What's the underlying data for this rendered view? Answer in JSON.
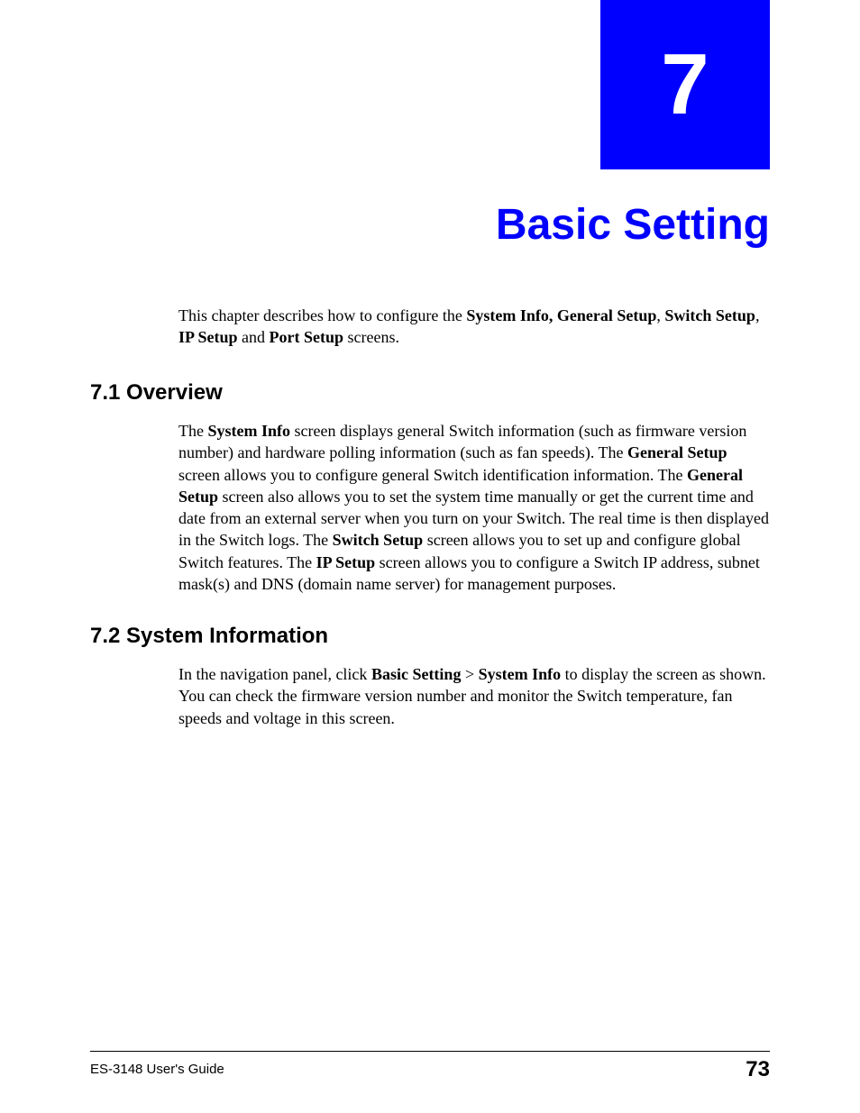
{
  "chapter": {
    "number": "7",
    "title": "Basic Setting"
  },
  "intro": {
    "prefix": "This chapter describes how to configure the ",
    "bold1": "System Info, General Setup",
    "mid1": ", ",
    "bold2": "Switch Setup",
    "mid2": ", ",
    "bold3": "IP Setup",
    "mid3": " and ",
    "bold4": "Port Setup",
    "suffix": " screens."
  },
  "section1": {
    "heading": "7.1  Overview",
    "p1_a": "The ",
    "p1_b": "System Info",
    "p1_c": " screen displays general Switch information (such as firmware version number) and hardware polling information (such as fan speeds). The ",
    "p1_d": "General Setup",
    "p1_e": " screen allows you to configure general Switch identification information. The ",
    "p1_f": "General Setup",
    "p1_g": " screen also allows you to set the system time manually or get the current time and date from an external server when you turn on your Switch. The real time is then displayed in the Switch logs. The ",
    "p1_h": "Switch Setup",
    "p1_i": " screen allows you to set up and configure global Switch features. The ",
    "p1_j": "IP Setup",
    "p1_k": " screen allows you to configure a Switch IP address, subnet mask(s) and DNS (domain name server) for management purposes."
  },
  "section2": {
    "heading": "7.2  System Information",
    "p1_a": "In the navigation panel, click ",
    "p1_b": "Basic Setting",
    "p1_c": " > ",
    "p1_d": "System Info",
    "p1_e": " to display the screen as shown. You can check the firmware version number and monitor the Switch temperature, fan speeds and voltage in this screen."
  },
  "footer": {
    "left": "ES-3148 User's Guide",
    "right": "73"
  }
}
